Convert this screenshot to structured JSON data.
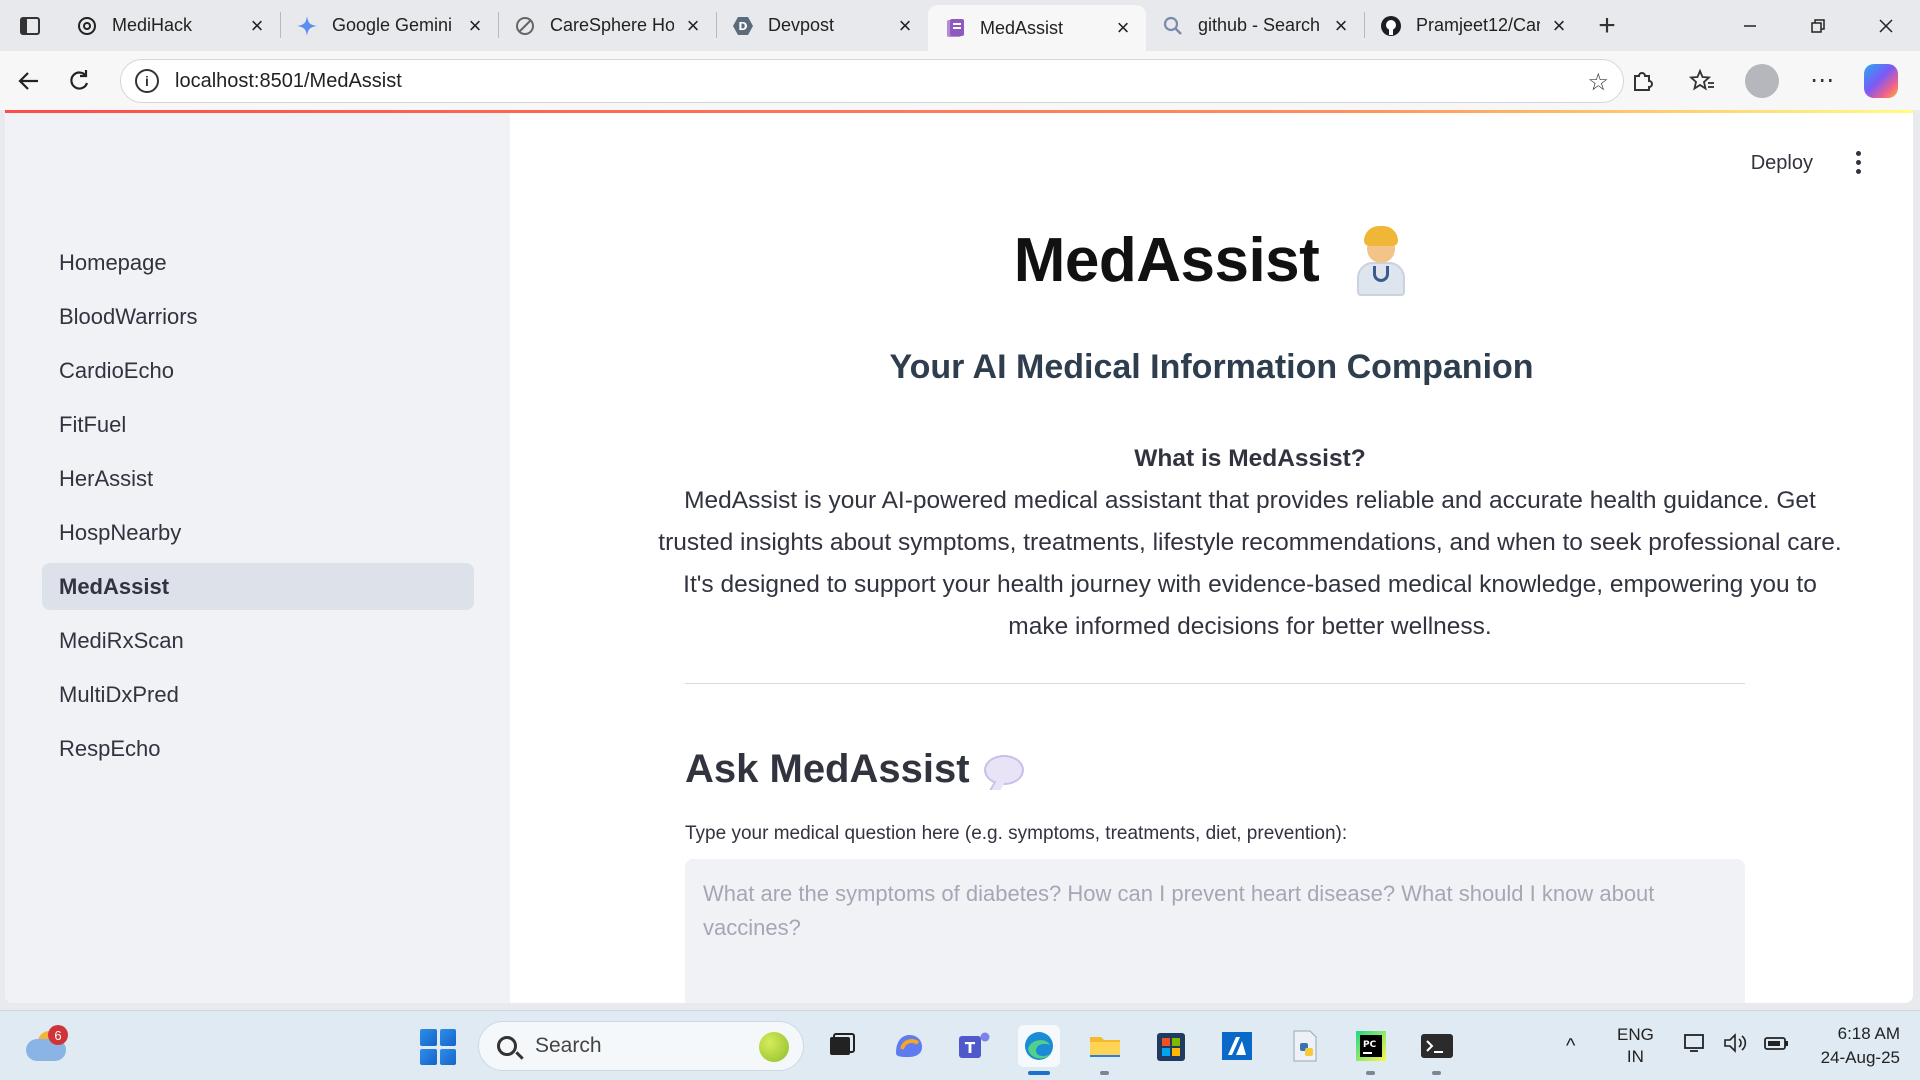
{
  "browser": {
    "tabs": [
      {
        "title": "MediHack",
        "icon": "chatgpt-icon",
        "active": false
      },
      {
        "title": "Google Gemini",
        "icon": "gemini-icon",
        "active": false
      },
      {
        "title": "CareSphere Hom",
        "icon": "slash-icon",
        "active": false
      },
      {
        "title": "Devpost",
        "icon": "devpost-icon",
        "active": false
      },
      {
        "title": "MedAssist",
        "icon": "streamlit-app-icon",
        "active": true
      },
      {
        "title": "github - Search",
        "icon": "search-icon",
        "active": false
      },
      {
        "title": "Pramjeet12/Car",
        "icon": "github-icon",
        "active": false
      }
    ],
    "url": "localhost:8501/MedAssist"
  },
  "sidebar": {
    "items": [
      {
        "label": "Homepage",
        "active": false
      },
      {
        "label": "BloodWarriors",
        "active": false
      },
      {
        "label": "CardioEcho",
        "active": false
      },
      {
        "label": "FitFuel",
        "active": false
      },
      {
        "label": "HerAssist",
        "active": false
      },
      {
        "label": "HospNearby",
        "active": false
      },
      {
        "label": "MedAssist",
        "active": true
      },
      {
        "label": "MediRxScan",
        "active": false
      },
      {
        "label": "MultiDxPred",
        "active": false
      },
      {
        "label": "RespEcho",
        "active": false
      }
    ]
  },
  "header": {
    "deploy_label": "Deploy"
  },
  "main": {
    "title": "MedAssist",
    "title_icon": "doctor-emoji-icon",
    "subtitle": "Your AI Medical Information Companion",
    "about_heading": "What is MedAssist?",
    "about_text": "MedAssist is your AI-powered medical assistant that provides reliable and accurate health guidance. Get trusted insights about symptoms, treatments, lifestyle recommendations, and when to seek professional care. It's designed to support your health journey with evidence-based medical knowledge, empowering you to make informed decisions for better wellness.",
    "ask_title": "Ask MedAssist",
    "ask_icon": "speech-bubble-icon",
    "question_label": "Type your medical question here (e.g. symptoms, treatments, diet, prevention):",
    "question_placeholder": "What are the symptoms of diabetes? How can I prevent heart disease? What should I know about vaccines?",
    "question_value": ""
  },
  "taskbar": {
    "weather_badge": "6",
    "search_placeholder": "Search",
    "language_line1": "ENG",
    "language_line2": "IN",
    "time": "6:18 AM",
    "date": "24-Aug-25"
  },
  "colors": {
    "accent": "#ff4b4b",
    "sidebar_bg": "#f0f2f6",
    "active_nav_bg": "#dde1ea",
    "text": "#31333f"
  }
}
